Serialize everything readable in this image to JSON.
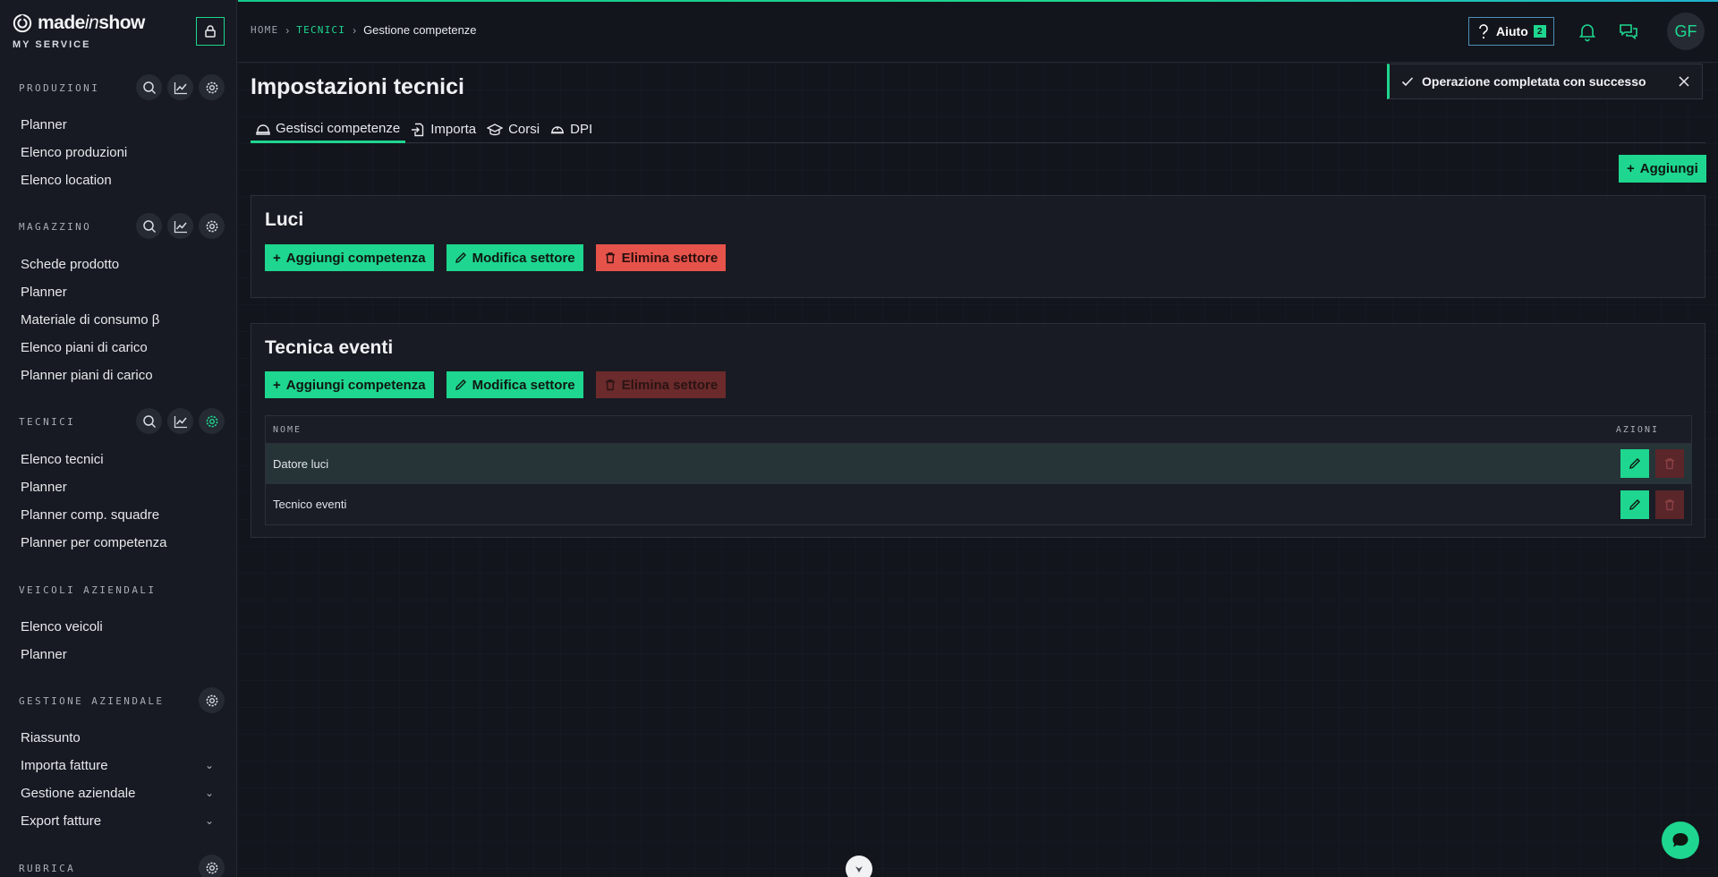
{
  "brand": {
    "name_a": "made",
    "name_b": "in",
    "name_c": "show",
    "subtitle": "MY SERVICE"
  },
  "colors": {
    "accent": "#1ed68f",
    "danger": "#e5534b",
    "background": "#12151c",
    "sidebar": "#171a22",
    "help_border": "#4e8fb8"
  },
  "sidebar": {
    "sections": [
      {
        "title": "PRODUZIONI",
        "icons": [
          "search-icon",
          "chart-icon",
          "gear-icon"
        ],
        "items": [
          "Planner",
          "Elenco produzioni",
          "Elenco location"
        ]
      },
      {
        "title": "MAGAZZINO",
        "icons": [
          "search-icon",
          "chart-icon",
          "gear-icon"
        ],
        "items": [
          "Schede prodotto",
          "Planner",
          "Materiale di consumo β",
          "Elenco piani di carico",
          "Planner piani di carico"
        ]
      },
      {
        "title": "TECNICI",
        "icons": [
          "search-icon",
          "chart-icon",
          "gear-icon"
        ],
        "items": [
          "Elenco tecnici",
          "Planner",
          "Planner comp. squadre",
          "Planner per competenza"
        ]
      },
      {
        "title": "VEICOLI AZIENDALI",
        "icons": [],
        "items": [
          "Elenco veicoli",
          "Planner"
        ]
      },
      {
        "title": "GESTIONE AZIENDALE",
        "icons": [
          "gear-icon"
        ],
        "items": [
          "Riassunto",
          "Importa fatture",
          "Gestione aziendale",
          "Export fatture"
        ]
      },
      {
        "title": "RUBRICA",
        "icons": [
          "gear-icon"
        ],
        "items": []
      }
    ]
  },
  "header": {
    "breadcrumb": {
      "home": "HOME",
      "section": "TECNICI",
      "current": "Gestione competenze"
    },
    "help_label": "Aiuto",
    "help_count": "2",
    "avatar_initials": "GF"
  },
  "main": {
    "title": "Impostazioni tecnici",
    "tabs": [
      {
        "label": "Gestisci competenze",
        "icon": "hardhat-icon",
        "active": true
      },
      {
        "label": "Importa",
        "icon": "import-icon",
        "active": false
      },
      {
        "label": "Corsi",
        "icon": "graduation-cap-icon",
        "active": false
      },
      {
        "label": "DPI",
        "icon": "helmet-icon",
        "active": false
      }
    ],
    "add_label": "Aggiungi",
    "sectors": [
      {
        "name": "Luci",
        "add_skill": "Aggiungi competenza",
        "edit_sector": "Modifica settore",
        "delete_sector": "Elimina settore",
        "delete_enabled": true,
        "skills": []
      },
      {
        "name": "Tecnica eventi",
        "add_skill": "Aggiungi competenza",
        "edit_sector": "Modifica settore",
        "delete_sector": "Elimina settore",
        "delete_enabled": false,
        "columns": {
          "name": "NOME",
          "actions": "AZIONI"
        },
        "skills": [
          "Datore luci",
          "Tecnico eventi"
        ]
      }
    ]
  },
  "toast": {
    "message": "Operazione completata con successo"
  }
}
